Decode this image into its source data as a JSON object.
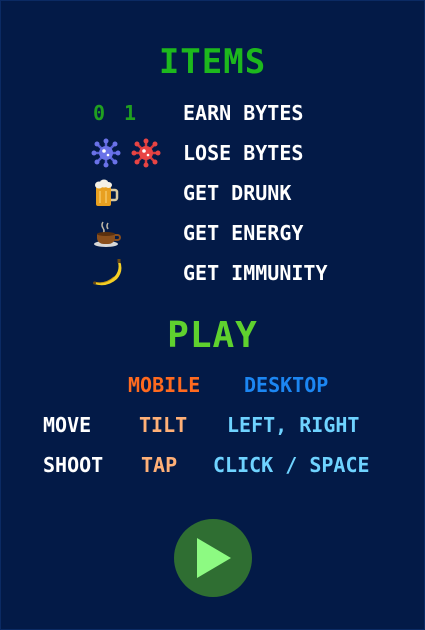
{
  "items": {
    "title": "ITEMS",
    "rows": [
      {
        "icons": [
          "0",
          "1"
        ],
        "label": "EARN BYTES",
        "icon_names": [
          "zero-bit-icon",
          "one-bit-icon"
        ]
      },
      {
        "label": "LOSE BYTES",
        "icon_names": [
          "blue-virus-icon",
          "red-virus-icon"
        ]
      },
      {
        "label": "GET DRUNK",
        "icon_names": [
          "beer-mug-icon"
        ]
      },
      {
        "label": "GET ENERGY",
        "icon_names": [
          "coffee-cup-icon"
        ]
      },
      {
        "label": "GET IMMUNITY",
        "icon_names": [
          "banana-icon"
        ]
      }
    ]
  },
  "play": {
    "title": "PLAY",
    "columns": {
      "mobile": "MOBILE",
      "desktop": "DESKTOP"
    },
    "controls": [
      {
        "action": "MOVE",
        "mobile": "TILT",
        "desktop": "LEFT, RIGHT"
      },
      {
        "action": "SHOOT",
        "mobile": "TAP",
        "desktop": "CLICK / SPACE"
      }
    ],
    "button_icon": "play-icon"
  },
  "colors": {
    "background": "#031a47",
    "items_title": "#1db81d",
    "play_title": "#5fd12e",
    "mobile_header": "#ff6a1f",
    "desktop_header": "#1c86f2",
    "mobile_value": "#ffb077",
    "desktop_value": "#6fd3ff",
    "play_button": "#2f6e32",
    "play_triangle": "#8dfa82"
  }
}
